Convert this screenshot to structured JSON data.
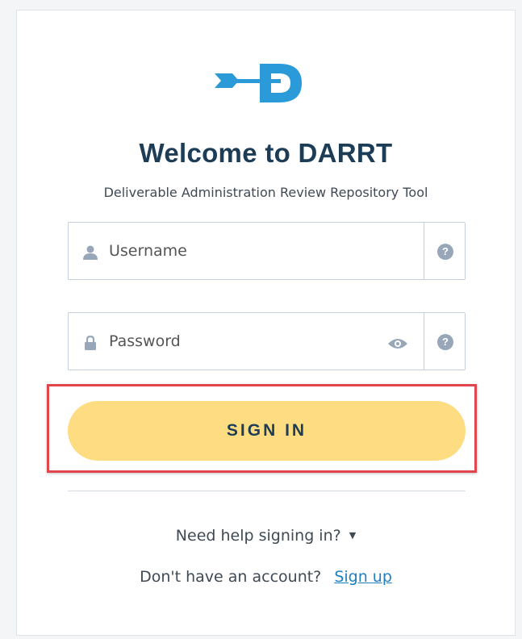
{
  "header": {
    "title": "Welcome to DARRT",
    "subtitle": "Deliverable Administration Review Repository Tool",
    "logo_icon": "darrt-dart-logo-icon"
  },
  "form": {
    "username": {
      "placeholder": "Username",
      "value": "",
      "icon": "user-icon",
      "help": "?"
    },
    "password": {
      "placeholder": "Password",
      "value": "",
      "icon": "lock-icon",
      "toggle_icon": "eye-icon",
      "help": "?"
    },
    "submit_label": "SIGN IN"
  },
  "footer": {
    "help_label": "Need help signing in?",
    "help_caret": "▼",
    "no_account_text": "Don't have an account?",
    "signup_label": "Sign up"
  },
  "colors": {
    "accent": "#2a9bd8",
    "title": "#1d3d57",
    "button": "#fedc82",
    "highlight": "#e0464c",
    "link": "#1f7fbf"
  }
}
